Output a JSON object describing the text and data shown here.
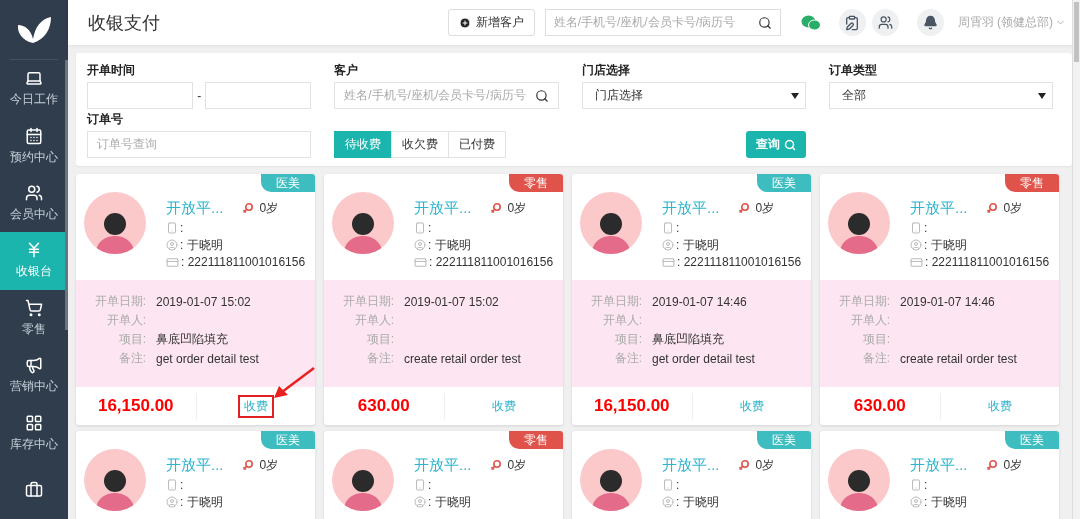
{
  "sidebar": {
    "items": [
      {
        "label": "今日工作",
        "selected": false
      },
      {
        "label": "预约中心",
        "selected": false
      },
      {
        "label": "会员中心",
        "selected": false
      },
      {
        "label": "收银台",
        "selected": true
      },
      {
        "label": "零售",
        "selected": false
      },
      {
        "label": "营销中心",
        "selected": false
      },
      {
        "label": "库存中心",
        "selected": false
      },
      {
        "selected": false
      }
    ]
  },
  "header": {
    "title": "收银支付",
    "new_customer_button": "新增客户",
    "search": {
      "placeholder": "姓名/手机号/座机/会员卡号/病历号"
    },
    "user": "周霄羽 (领健总部)"
  },
  "filters": {
    "open_time": {
      "label": "开单时间",
      "separator": "-"
    },
    "customer": {
      "label": "客户",
      "placeholder": "姓名/手机号/座机/会员卡号/病历号"
    },
    "store": {
      "label": "门店选择",
      "value": "门店选择"
    },
    "order_type": {
      "label": "订单类型",
      "value": "全部"
    },
    "order_no": {
      "label": "订单号",
      "placeholder": "订单号查询"
    },
    "status_tabs": [
      {
        "label": "待收费",
        "selected": true
      },
      {
        "label": "收欠费",
        "selected": false
      },
      {
        "label": "已付费",
        "selected": false
      }
    ],
    "query_button": "查询"
  },
  "cards": [
    {
      "tag": {
        "text": "医美",
        "color": "#3dbdbf"
      },
      "name": "开放平...",
      "age": "0岁",
      "phone": ":",
      "doctor": ": 于晓明",
      "card_no": ": 222111811001016156",
      "details": [
        {
          "label": "开单日期:",
          "value": "2019-01-07 15:02"
        },
        {
          "label": "开单人:"
        },
        {
          "label": "项目:",
          "value": "鼻底凹陷填充"
        },
        {
          "label": "备注:",
          "value": "get order detail test"
        }
      ],
      "amount": "16,150.00",
      "action": "收费",
      "highlighted": true
    },
    {
      "tag": {
        "text": "零售",
        "color": "#e0534a"
      },
      "name": "开放平...",
      "age": "0岁",
      "phone": ":",
      "doctor": ": 于晓明",
      "card_no": ": 222111811001016156",
      "details": [
        {
          "label": "开单日期:",
          "value": "2019-01-07 15:02"
        },
        {
          "label": "开单人:"
        },
        {
          "label": "项目:"
        },
        {
          "label": "备注:",
          "value": "create retail order test"
        }
      ],
      "amount": "630.00",
      "action": "收费",
      "highlighted": false
    },
    {
      "tag": {
        "text": "医美",
        "color": "#3dbdbf"
      },
      "name": "开放平...",
      "age": "0岁",
      "phone": ":",
      "doctor": ": 于晓明",
      "card_no": ": 222111811001016156",
      "details": [
        {
          "label": "开单日期:",
          "value": "2019-01-07 14:46"
        },
        {
          "label": "开单人:"
        },
        {
          "label": "项目:",
          "value": "鼻底凹陷填充"
        },
        {
          "label": "备注:",
          "value": "get order detail test"
        }
      ],
      "amount": "16,150.00",
      "action": "收费",
      "highlighted": false
    },
    {
      "tag": {
        "text": "零售",
        "color": "#e0534a"
      },
      "name": "开放平...",
      "age": "0岁",
      "phone": ":",
      "doctor": ": 于晓明",
      "card_no": ": 222111811001016156",
      "details": [
        {
          "label": "开单日期:",
          "value": "2019-01-07 14:46"
        },
        {
          "label": "开单人:"
        },
        {
          "label": "项目:"
        },
        {
          "label": "备注:",
          "value": "create retail order test"
        }
      ],
      "amount": "630.00",
      "action": "收费",
      "highlighted": false
    },
    {
      "tag": {
        "text": "医美",
        "color": "#3dbdbf"
      },
      "name": "开放平...",
      "age": "0岁",
      "phone": ":",
      "doctor": ": 于晓明"
    },
    {
      "tag": {
        "text": "零售",
        "color": "#e0534a"
      },
      "name": "开放平...",
      "age": "0岁",
      "phone": ":",
      "doctor": ": 于晓明"
    },
    {
      "tag": {
        "text": "医美",
        "color": "#3dbdbf"
      },
      "name": "开放平...",
      "age": "0岁",
      "phone": ":",
      "doctor": ": 于晓明"
    },
    {
      "tag": {
        "text": "医美",
        "color": "#3dbdbf"
      },
      "name": "开放平...",
      "age": "0岁",
      "phone": ":",
      "doctor": ": 于晓明"
    }
  ]
}
